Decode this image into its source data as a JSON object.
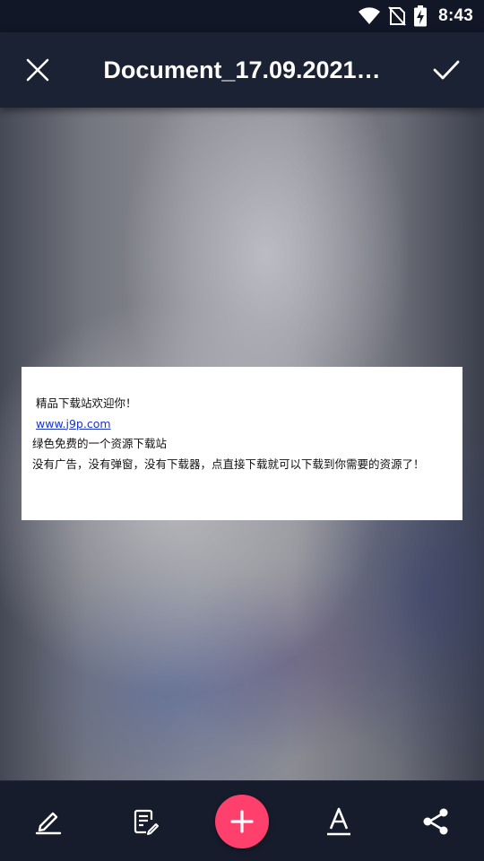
{
  "status_bar": {
    "time": "8:43",
    "icons": [
      "wifi-icon",
      "no-sim-icon",
      "battery-charging-icon"
    ]
  },
  "app_bar": {
    "title": "Document_17.09.2021…",
    "close_icon": "close-icon",
    "confirm_icon": "check-icon"
  },
  "document": {
    "lines": [
      "精品下载站欢迎你！",
      "www.j9p.com",
      "绿色免费的一个资源下载站",
      "没有广告，没有弹窗，没有下载器，点直接下载就可以下载到你需要的资源了！"
    ],
    "link_color": "#1a35c9"
  },
  "toolbar": {
    "items": [
      "pen-icon",
      "edit-note-icon",
      "add-icon",
      "text-icon",
      "share-icon"
    ],
    "accent": "#ff3f6c"
  }
}
